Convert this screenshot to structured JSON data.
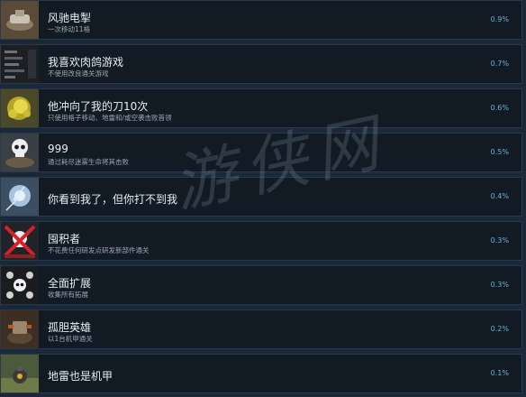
{
  "achievements": [
    {
      "title": "风驰电掣",
      "desc": "一次移动11格",
      "pct": "0.9%",
      "icon": "speeding-mech-icon"
    },
    {
      "title": "我喜欢肉鸽游戏",
      "desc": "不使用改良通关游戏",
      "pct": "0.7%",
      "icon": "upgrade-menu-icon"
    },
    {
      "title": "他冲向了我的刀10次",
      "desc": "只使用格子移动、地雷和/或空袭击败首领",
      "pct": "0.6%",
      "icon": "explosion-icon"
    },
    {
      "title": "999",
      "desc": "通过耗尽迷雾生命将其击败",
      "pct": "0.5%",
      "icon": "skull-icon"
    },
    {
      "title": "你看到我了，但你打不到我",
      "desc": "",
      "pct": "0.4%",
      "icon": "lightning-mech-icon"
    },
    {
      "title": "囤积者",
      "desc": "不花费任何研发点研发新部件通关",
      "pct": "0.3%",
      "icon": "crossed-skull-icon"
    },
    {
      "title": "全面扩展",
      "desc": "收集所有拓展",
      "pct": "0.3%",
      "icon": "skull-grid-icon"
    },
    {
      "title": "孤胆英雄",
      "desc": "以1台机甲通关",
      "pct": "0.2%",
      "icon": "lone-mech-icon"
    },
    {
      "title": "地雷也是机甲",
      "desc": "",
      "pct": "0.1%",
      "icon": "mine-icon"
    }
  ],
  "watermark": "游侠网"
}
